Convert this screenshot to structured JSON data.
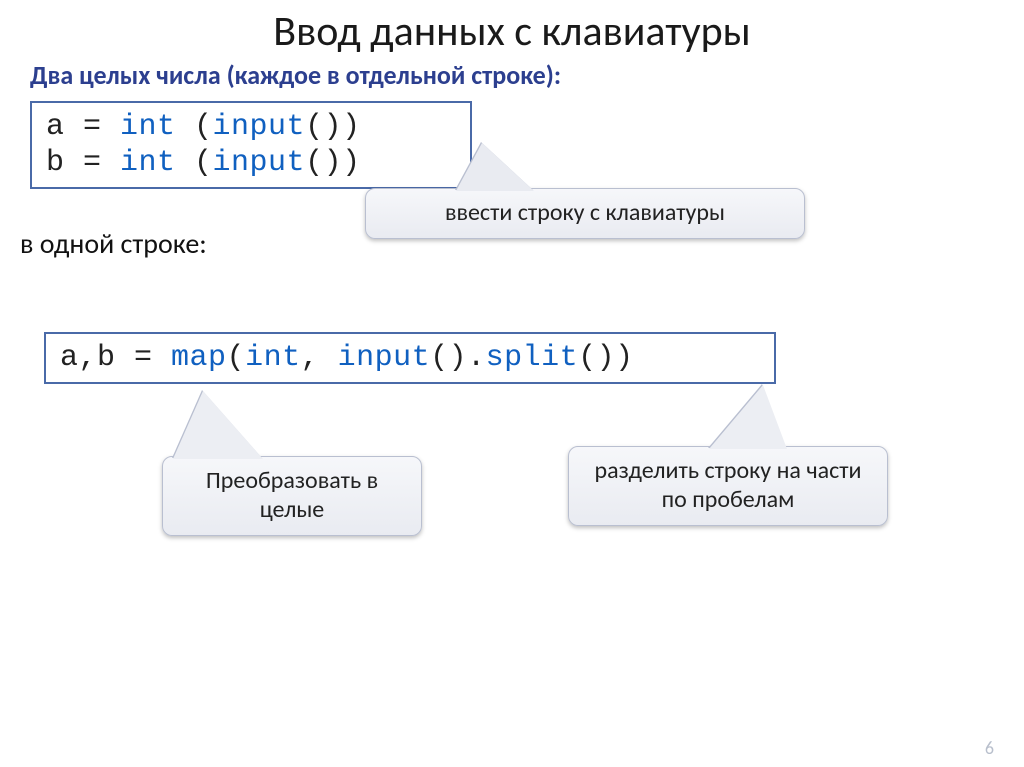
{
  "title": "Ввод данных с клавиатуры",
  "subtitle": "Два целых числа (каждое в отдельной строке):",
  "code1": {
    "a_var": "a = ",
    "b_var": "b = ",
    "int_kw": "int",
    "input_kw": "input",
    "paren_open": " (",
    "paren_close": "())"
  },
  "body_text": "в одной строке:",
  "callout_right": "ввести строку с клавиатуры",
  "code2": {
    "prefix": "a,b = ",
    "map_kw": "map",
    "open": "(",
    "int_kw": "int",
    "comma": ", ",
    "input_kw": "input",
    "mid": "().",
    "split_kw": "split",
    "end": "())"
  },
  "callout_bl": "Преобразовать в целые",
  "callout_br": "разделить строку на части по пробелам",
  "page_number": "6"
}
